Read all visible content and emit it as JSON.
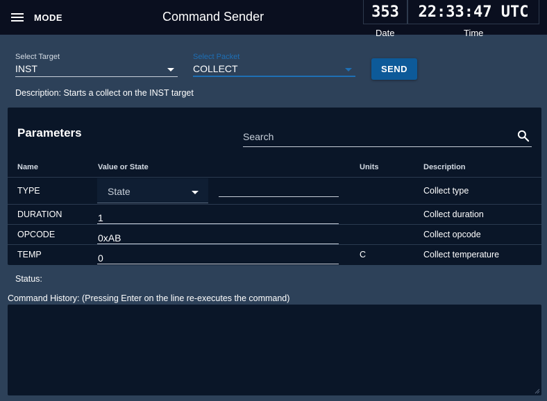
{
  "header": {
    "menu_label": "MODE",
    "title": "Command Sender"
  },
  "clock": {
    "date_value": "353",
    "time_value": "22:33:47 UTC",
    "date_label": "Date",
    "time_label": "Time"
  },
  "target": {
    "label": "Select Target",
    "value": "INST"
  },
  "packet": {
    "label": "Select Packet",
    "value": "COLLECT"
  },
  "send_label": "SEND",
  "description": "Description: Starts a collect on the INST target",
  "parameters": {
    "title": "Parameters",
    "search_placeholder": "Search",
    "columns": [
      "Name",
      "Value or State",
      "Units",
      "Description"
    ],
    "rows": [
      {
        "name": "TYPE",
        "state": "State",
        "value": "",
        "units": "",
        "description": "Collect type"
      },
      {
        "name": "DURATION",
        "value": "1",
        "units": "",
        "description": "Collect duration"
      },
      {
        "name": "OPCODE",
        "value": "0xAB",
        "units": "",
        "description": "Collect opcode"
      },
      {
        "name": "TEMP",
        "value": "0",
        "units": "C",
        "description": "Collect temperature"
      }
    ]
  },
  "status_label": "Status:",
  "history_label": "Command History: (Pressing Enter on the line re-executes the command)",
  "colors": {
    "background": "#2d4159",
    "topbar": "#0a0f1f",
    "card": "#0a1628",
    "accent": "#0d5a99",
    "packet_label": "#1e6fb5"
  },
  "icons": [
    "hamburger-icon",
    "chevron-down-icon",
    "search-icon",
    "resize-handle-icon"
  ]
}
